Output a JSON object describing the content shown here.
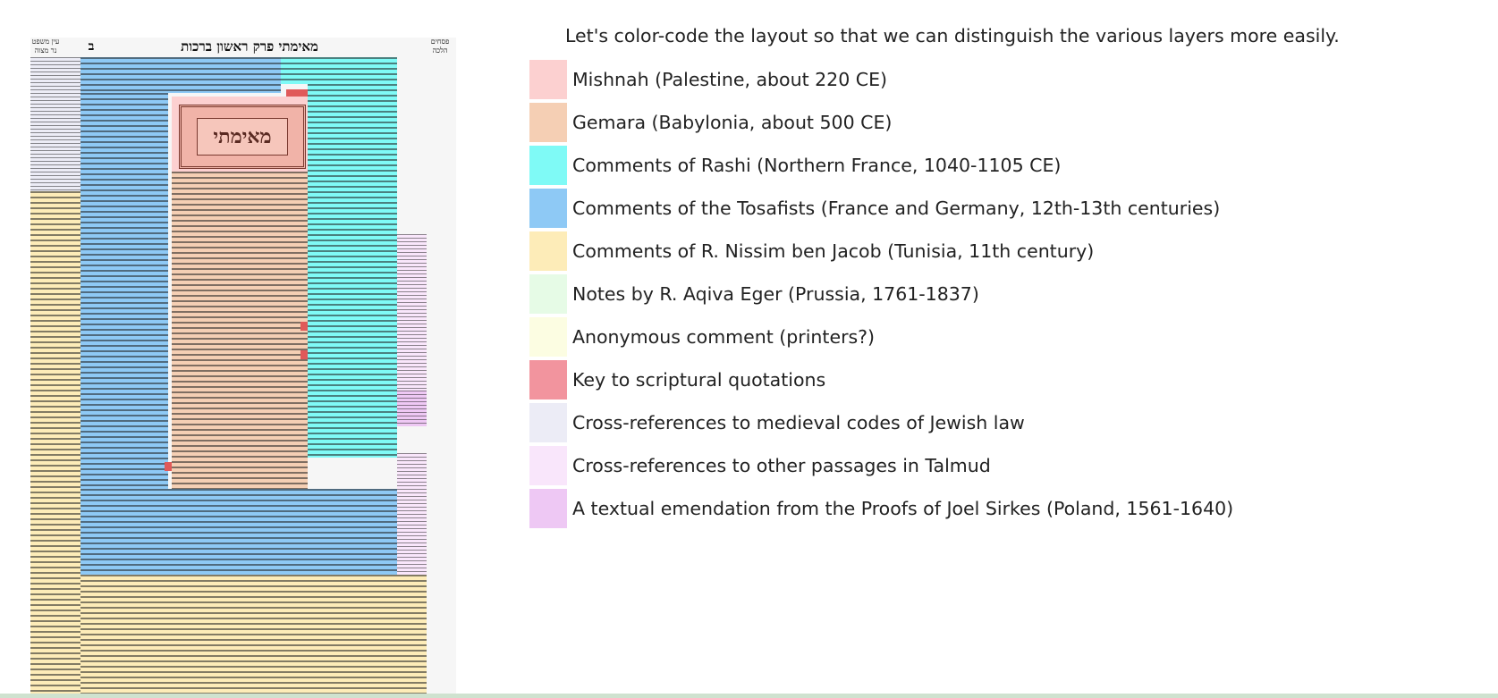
{
  "intro": "Let's color-code the layout so that we can distinguish the various layers more easily.",
  "talmud_page": {
    "header_title": "מאימתי   פרק ראשון   ברכות",
    "header_letter": "ב",
    "header_left_note": "פסחים הלכה",
    "header_right_note": "עין משפט נר מצוה",
    "title_word": "מאימתי"
  },
  "legend": [
    {
      "label": "Mishnah (Palestine, about 220 CE)",
      "color": "#fcd0d0"
    },
    {
      "label": "Gemara (Babylonia, about 500 CE)",
      "color": "#f5cfb4"
    },
    {
      "label": "Comments of Rashi (Northern France, 1040-1105 CE)",
      "color": "#7ffaf6"
    },
    {
      "label": "Comments of the Tosafists (France and Germany, 12th-13th centuries)",
      "color": "#8ec9f5"
    },
    {
      "label": "Comments of R. Nissim ben Jacob (Tunisia, 11th century)",
      "color": "#fdecb8"
    },
    {
      "label": "Notes by R. Aqiva Eger (Prussia, 1761-1837)",
      "color": "#e6fbe6"
    },
    {
      "label": "Anonymous comment (printers?)",
      "color": "#fcfde2"
    },
    {
      "label": "Key to scriptural quotations",
      "color": "#f2949e"
    },
    {
      "label": "Cross-references to medieval codes of Jewish law",
      "color": "#ececf6"
    },
    {
      "label": "Cross-references to other passages in Talmud",
      "color": "#f9e6fb"
    },
    {
      "label": "A textual emendation from the Proofs of Joel Sirkes (Poland, 1561-1640)",
      "color": "#eec8f4"
    }
  ]
}
